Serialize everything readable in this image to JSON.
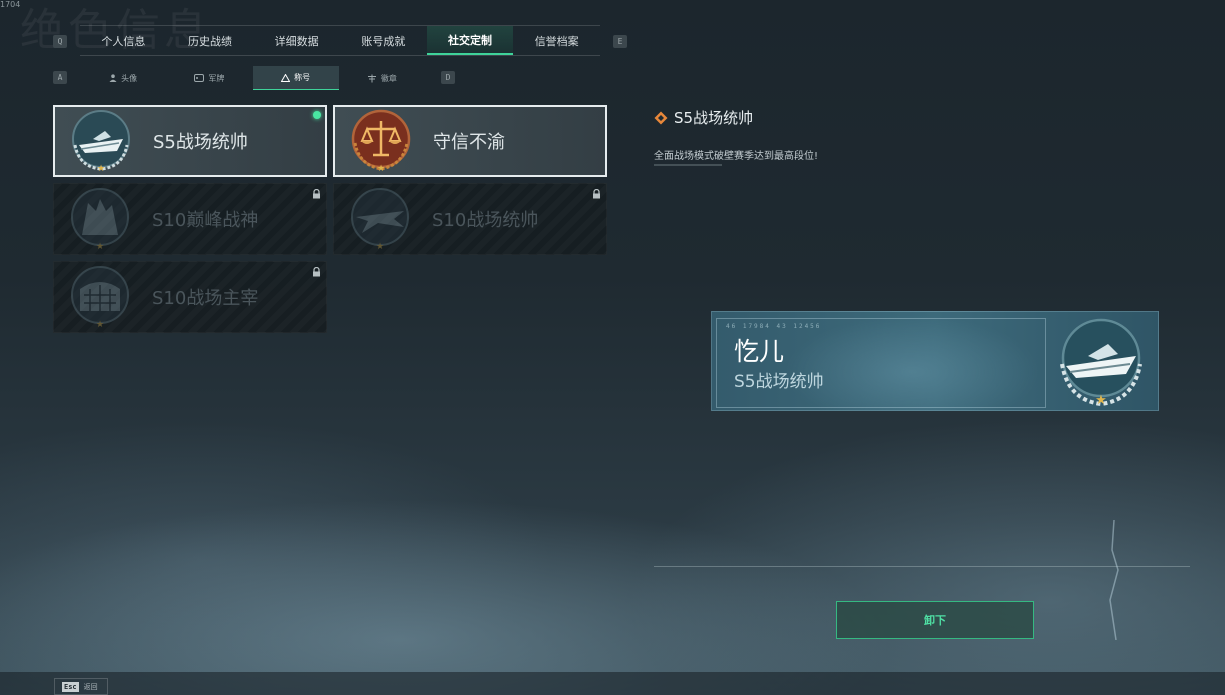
{
  "page": {
    "background_title": "绝色信息",
    "corner_code": "1704"
  },
  "main_tabs": {
    "left_key": "Q",
    "right_key": "E",
    "items": [
      {
        "label": "个人信息",
        "active": false
      },
      {
        "label": "历史战绩",
        "active": false
      },
      {
        "label": "详细数据",
        "active": false
      },
      {
        "label": "账号成就",
        "active": false
      },
      {
        "label": "社交定制",
        "active": true
      },
      {
        "label": "信誉档案",
        "active": false
      }
    ]
  },
  "sub_tabs": {
    "left_key": "A",
    "right_key": "D",
    "items": [
      {
        "label": "头像",
        "icon": "person-icon",
        "active": false
      },
      {
        "label": "军牌",
        "icon": "dogtag-icon",
        "active": false
      },
      {
        "label": "称号",
        "icon": "triangle-icon",
        "active": true
      },
      {
        "label": "徽章",
        "icon": "badge-icon",
        "active": false
      }
    ]
  },
  "titles": [
    {
      "label": "S5战场统帅",
      "emblem": "boat-emblem",
      "status": "equipped"
    },
    {
      "label": "守信不渝",
      "emblem": "scales-emblem",
      "status": "unlocked"
    },
    {
      "label": "S10巅峰战神",
      "emblem": "castle-emblem",
      "status": "locked"
    },
    {
      "label": "S10战场统帅",
      "emblem": "plane-emblem",
      "status": "locked"
    },
    {
      "label": "S10战场主宰",
      "emblem": "colosseum-emblem",
      "status": "locked"
    }
  ],
  "detail": {
    "title": "S5战场统帅",
    "description": "全面战场模式破壁赛季达到最高段位!"
  },
  "preview": {
    "code": "46 17984 43 12456",
    "player_name": "忔儿",
    "title": "S5战场统帅"
  },
  "actions": {
    "unequip_label": "卸下",
    "back_key": "Esc",
    "back_label": "返回"
  },
  "colors": {
    "accent_green": "#3fd39a",
    "star_gold": "#e0b54b"
  }
}
